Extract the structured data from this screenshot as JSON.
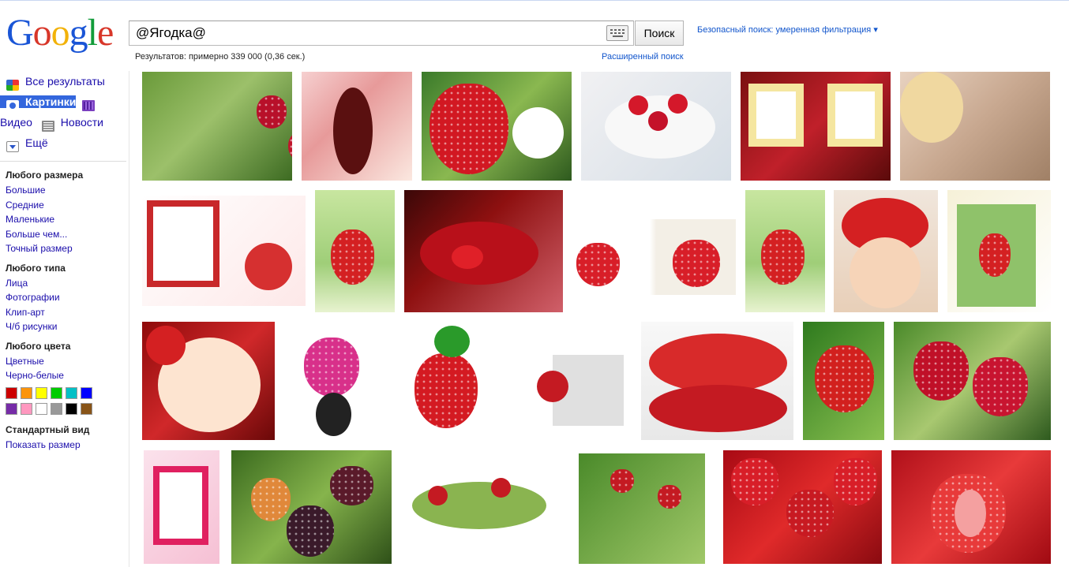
{
  "logo": {
    "letters": [
      "G",
      "o",
      "o",
      "g",
      "l",
      "e"
    ]
  },
  "search": {
    "query": "@Ягодка@",
    "button_label": "Поиск",
    "keyboard_icon": "keyboard-icon"
  },
  "safe_search": "Безопасный поиск: умеренная фильтрация ▾",
  "result_stats": "Результатов: примерно 339 000 (0,36 сек.)",
  "advanced_search": "Расширенный поиск",
  "nav": [
    {
      "label": "Все результаты",
      "icon": "google-plus-icon",
      "active": false
    },
    {
      "label": "Картинки",
      "icon": "camera-icon",
      "active": true
    },
    {
      "label": "Видео",
      "icon": "film-icon",
      "active": false
    },
    {
      "label": "Новости",
      "icon": "newspaper-icon",
      "active": false
    },
    {
      "label": "Ещё",
      "icon": "dropdown-icon",
      "active": false
    }
  ],
  "filters": {
    "size": {
      "heading": "Любого размера",
      "options": [
        "Большие",
        "Средние",
        "Маленькие",
        "Больше чем...",
        "Точный размер"
      ]
    },
    "type": {
      "heading": "Любого типа",
      "options": [
        "Лица",
        "Фотографии",
        "Клип-арт",
        "Ч/б рисунки"
      ]
    },
    "color": {
      "heading": "Любого цвета",
      "options": [
        "Цветные",
        "Черно-белые"
      ],
      "swatches": [
        "#cc0000",
        "#fb940b",
        "#ffff00",
        "#00cc00",
        "#03c0c6",
        "#0000ff",
        "#762ca7",
        "#ff98bf",
        "#ffffff",
        "#999999",
        "#000000",
        "#885418"
      ]
    },
    "view": {
      "heading": "Стандартный вид",
      "options": [
        "Показать размер"
      ]
    }
  },
  "colors": {
    "link": "#1a0dab",
    "active_nav": "#3366dd",
    "accent_link": "#1155cc"
  }
}
